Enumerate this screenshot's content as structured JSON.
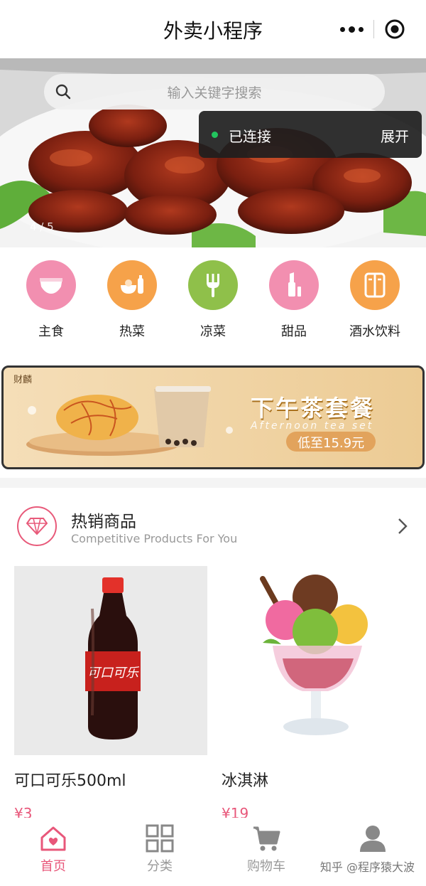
{
  "nav": {
    "title": "外卖小程序"
  },
  "search": {
    "placeholder": "输入关键字搜索"
  },
  "connection": {
    "status": "已连接",
    "expand": "展开"
  },
  "banner": {
    "indicator": "4 / 5"
  },
  "categories": [
    {
      "label": "主食",
      "color": "#f28fb0",
      "icon": "diaper-icon"
    },
    {
      "label": "热菜",
      "color": "#f6a24a",
      "icon": "bowl-icon"
    },
    {
      "label": "凉菜",
      "color": "#8fc04a",
      "icon": "fork-icon"
    },
    {
      "label": "甜品",
      "color": "#f28fb0",
      "icon": "lipstick-icon"
    },
    {
      "label": "酒水饮料",
      "color": "#f6a24a",
      "icon": "fridge-icon"
    }
  ],
  "promo": {
    "logo": "财麟",
    "title": "下午茶套餐",
    "subtitle": "Afternoon tea set",
    "price": "低至15.9元"
  },
  "hot": {
    "title": "热销商品",
    "subtitle": "Competitive Products For You"
  },
  "products": [
    {
      "name": "可口可乐500ml",
      "price": "¥3"
    },
    {
      "name": "冰淇淋",
      "price": "¥19"
    }
  ],
  "tabs": [
    {
      "label": "首页",
      "icon": "home-icon",
      "active": true
    },
    {
      "label": "分类",
      "icon": "grid-icon",
      "active": false
    },
    {
      "label": "购物车",
      "icon": "cart-icon",
      "active": false
    },
    {
      "label": "",
      "icon": "user-icon",
      "active": false
    }
  ],
  "watermark": "知乎 @程序猿大波",
  "colors": {
    "accent": "#e8577a",
    "connected": "#22c55e"
  }
}
